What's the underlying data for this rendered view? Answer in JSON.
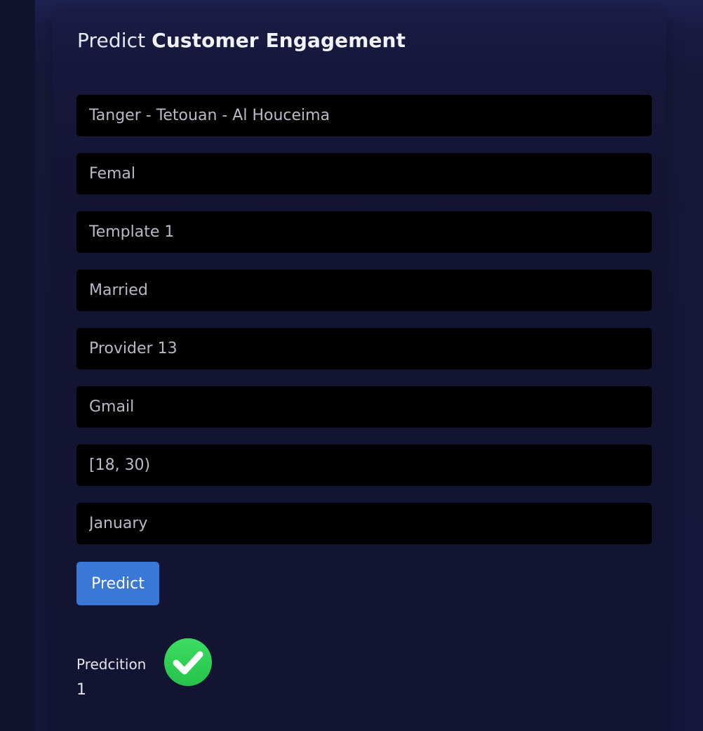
{
  "form": {
    "title_prefix": "Predict",
    "title_bold": "Customer Engagement",
    "fields": [
      {
        "value": "Tanger - Tetouan - Al Houceima"
      },
      {
        "value": "Femal"
      },
      {
        "value": "Template 1"
      },
      {
        "value": "Married"
      },
      {
        "value": "Provider 13"
      },
      {
        "value": "Gmail"
      },
      {
        "value": "[18, 30)"
      },
      {
        "value": "January"
      }
    ],
    "submit_label": "Predict"
  },
  "result": {
    "label": "Predcition",
    "value": "1",
    "icon": "check-circle-icon",
    "icon_color": "#2ecc52"
  },
  "colors": {
    "accent": "#3a78d8",
    "background": "#141531",
    "field_bg": "#000000"
  }
}
